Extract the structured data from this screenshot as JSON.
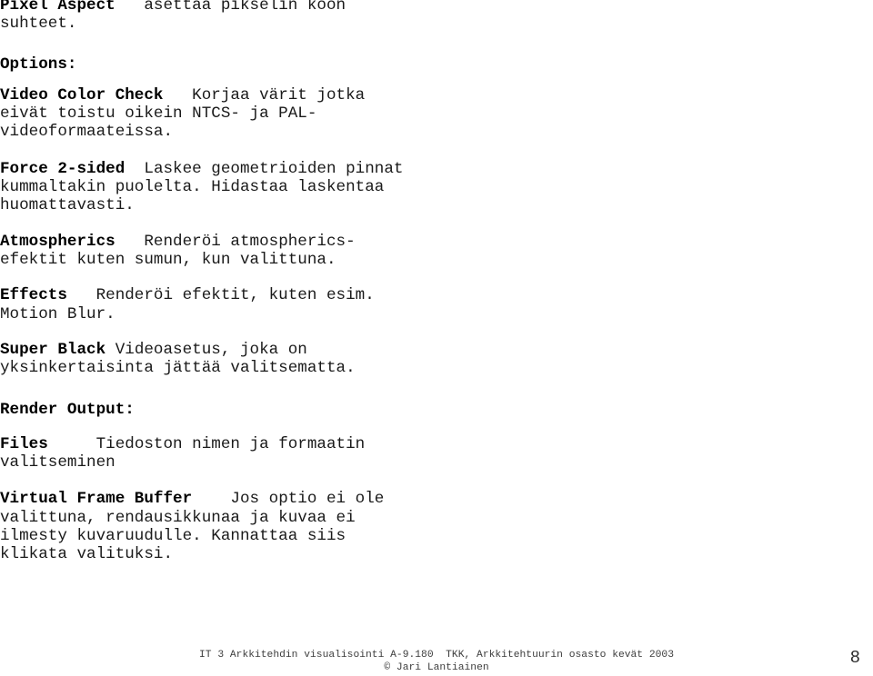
{
  "document": {
    "page_number": "8",
    "blocks": [
      {
        "id": "pixel-aspect",
        "kind": "definition",
        "term": "Pixel Aspect",
        "text": "   asettaa pikselin koon\nsuhteet."
      },
      {
        "id": "options",
        "kind": "heading",
        "text": "Options:"
      },
      {
        "id": "video-color-check",
        "kind": "definition",
        "term": "Video Color Check",
        "text": "   Korjaa värit jotka\neivät toistu oikein NTCS- ja PAL-\nvideoformaateissa."
      },
      {
        "id": "force-2-sided",
        "kind": "definition",
        "term": "Force 2-sided",
        "text": "  Laskee geometrioiden pinnat\nkummaltakin puolelta. Hidastaa laskentaa\nhuomattavasti."
      },
      {
        "id": "atmospherics",
        "kind": "definition",
        "term": "Atmospherics",
        "text": "   Renderöi atmospherics-\nefektit kuten sumun, kun valittuna."
      },
      {
        "id": "effects",
        "kind": "definition",
        "term": "Effects",
        "text": "   Renderöi efektit, kuten esim.\nMotion Blur."
      },
      {
        "id": "super-black",
        "kind": "definition",
        "term": "Super Black",
        "text": " Videoasetus, joka on\nyksinkertaisinta jättää valitsematta."
      },
      {
        "id": "render-output",
        "kind": "heading",
        "text": "Render Output:"
      },
      {
        "id": "files",
        "kind": "definition",
        "term": "Files",
        "text": "     Tiedoston nimen ja formaatin\nvalitseminen"
      },
      {
        "id": "virtual-frame-buffer",
        "kind": "definition",
        "term": "Virtual Frame Buffer",
        "text": "    Jos optio ei ole\nvalittuna, rendausikkunaa ja kuvaa ei\nilmesty kuvaruudulle. Kannattaa siis\nklikata valituksi."
      }
    ],
    "footer": {
      "course_line": "IT 3 Arkkitehdin visualisointi A-9.180  TKK, Arkkitehtuurin osasto kevät 2003",
      "copyright": "© Jari Lantiainen"
    }
  }
}
